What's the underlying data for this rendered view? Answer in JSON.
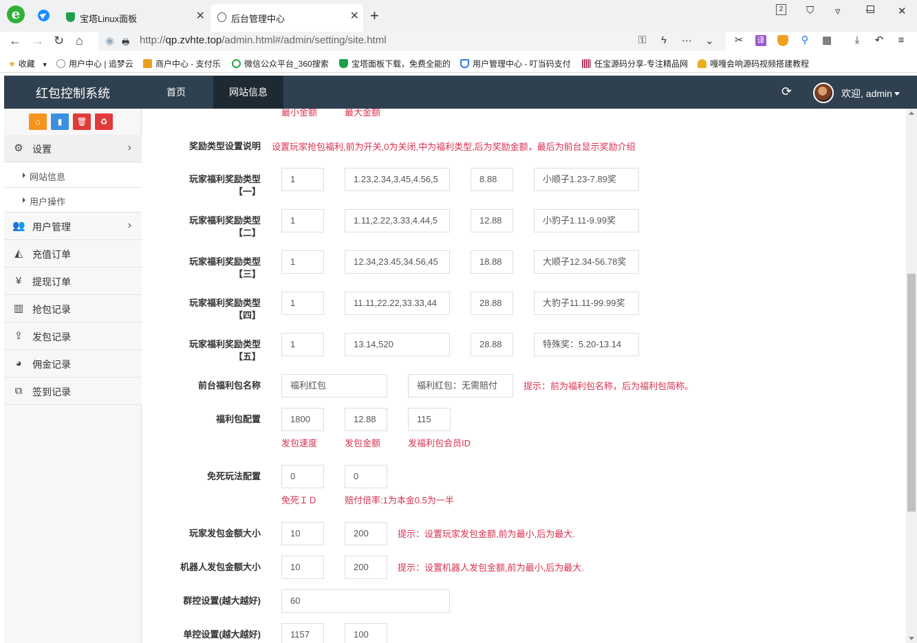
{
  "browser": {
    "tabs": [
      {
        "title": "宝塔Linux面板",
        "icon": "shield-icon"
      },
      {
        "title": "后台管理中心",
        "icon": "globe-icon"
      }
    ],
    "url_prefix": "http://",
    "url_host": "qp.zvhte.top",
    "url_path": "/admin.html#/admin/setting/site.html",
    "tab_counter": "2",
    "bookmarks": [
      {
        "label": "收藏",
        "icon": "star-icon",
        "color": "#f5a623"
      },
      {
        "label": "用户中心 | 追梦云",
        "icon": "globe-icon",
        "color": "#888888"
      },
      {
        "label": "商户中心 - 支付乐",
        "icon": "smile-icon",
        "color": "#e8a020"
      },
      {
        "label": "微信公众平台_360搜索",
        "icon": "search-icon",
        "color": "#27a844"
      },
      {
        "label": "宝塔面板下载，免费全能的",
        "icon": "shield-icon",
        "color": "#1e9f4a"
      },
      {
        "label": "用户管理中心 - 叮当码支付",
        "icon": "shield-icon",
        "color": "#2d7be5"
      },
      {
        "label": "任宝源码分享-专注精品网",
        "icon": "barcode-icon",
        "color": "#b03060"
      },
      {
        "label": "嘎嘎会响源码视频搭建教程",
        "icon": "crown-icon",
        "color": "#e8b020"
      }
    ]
  },
  "app": {
    "brand": "红包控制系统",
    "nav": [
      "首页",
      "网站信息"
    ],
    "welcome": "欢迎, admin"
  },
  "sidebar": {
    "quick_buttons": [
      {
        "icon": "home-icon",
        "color": "#f7941d"
      },
      {
        "icon": "file-icon",
        "color": "#3b8fe0"
      },
      {
        "icon": "trash-icon",
        "color": "#e03a3a"
      },
      {
        "icon": "recycle-icon",
        "color": "#e03a3a"
      }
    ],
    "settings": "设置",
    "sub_items": [
      "网站信息",
      "用户操作"
    ],
    "items": [
      {
        "label": "用户管理",
        "icon": "users-icon"
      },
      {
        "label": "充值订单",
        "icon": "area-chart-icon"
      },
      {
        "label": "提现订单",
        "icon": "yen-icon"
      },
      {
        "label": "抢包记录",
        "icon": "bar-chart-icon"
      },
      {
        "label": "发包记录",
        "icon": "upload-icon"
      },
      {
        "label": "佣金记录",
        "icon": "pie-chart-icon"
      },
      {
        "label": "签到记录",
        "icon": "clone-icon"
      }
    ]
  },
  "form": {
    "top_hints": [
      "最小金额",
      "最大金额"
    ],
    "reward_desc_label": "奖励类型设置说明",
    "reward_desc_text": "设置玩家抢包福利,前为开关,0为关闭,中为福利类型,后为奖励金额，最后为前台显示奖励介绍",
    "reward_label": "玩家福利奖励类型",
    "rewards": [
      {
        "index": "【一】",
        "switch": "1",
        "type": "1.23,2.34,3.45,4.56,5",
        "amount": "8.88",
        "desc": "小顺子1.23-7.89奖"
      },
      {
        "index": "【二】",
        "switch": "1",
        "type": "1.11,2.22,3.33,4.44,5",
        "amount": "12.88",
        "desc": "小豹子1.11-9.99奖"
      },
      {
        "index": "【三】",
        "switch": "1",
        "type": "12.34,23.45,34.56,45",
        "amount": "18.88",
        "desc": "大顺子12.34-56.78奖"
      },
      {
        "index": "【四】",
        "switch": "1",
        "type": "11.11,22.22,33.33,44",
        "amount": "28.88",
        "desc": "大豹子11.11-99.99奖"
      },
      {
        "index": "【五】",
        "switch": "1",
        "type": "13.14,520",
        "amount": "28.88",
        "desc": "特殊奖：5.20-13.14"
      }
    ],
    "bonus_name_label": "前台福利包名称",
    "bonus_name": "福利红包",
    "bonus_short": "福利红包：无需赔付",
    "bonus_name_hint": "提示：前为福利包名称，后为福利包简称。",
    "bonus_config_label": "福利包配置",
    "bonus_speed": "1800",
    "bonus_amount": "12.88",
    "bonus_member": "115",
    "bonus_speed_hint": "发包速度",
    "bonus_amount_hint": "发包金额",
    "bonus_member_hint": "发福利包会员ID",
    "nodeath_label": "免死玩法配置",
    "nodeath_id": "0",
    "nodeath_rate": "0",
    "nodeath_id_hint": "免死ＩＤ",
    "nodeath_rate_hint": "赔付倍率:1为本金0.5为一半",
    "player_amount_label": "玩家发包金额大小",
    "player_min": "10",
    "player_max": "200",
    "player_hint": "提示：设置玩家发包金额,前为最小,后为最大.",
    "robot_amount_label": "机器人发包金额大小",
    "robot_min": "10",
    "robot_max": "200",
    "robot_hint": "提示：设置机器人发包金额,前为最小,后为最大.",
    "group_label": "群控设置(越大越好)",
    "group_value": "60",
    "single_label": "单控设置(越大越好)",
    "single_a": "1157",
    "single_b": "100"
  }
}
